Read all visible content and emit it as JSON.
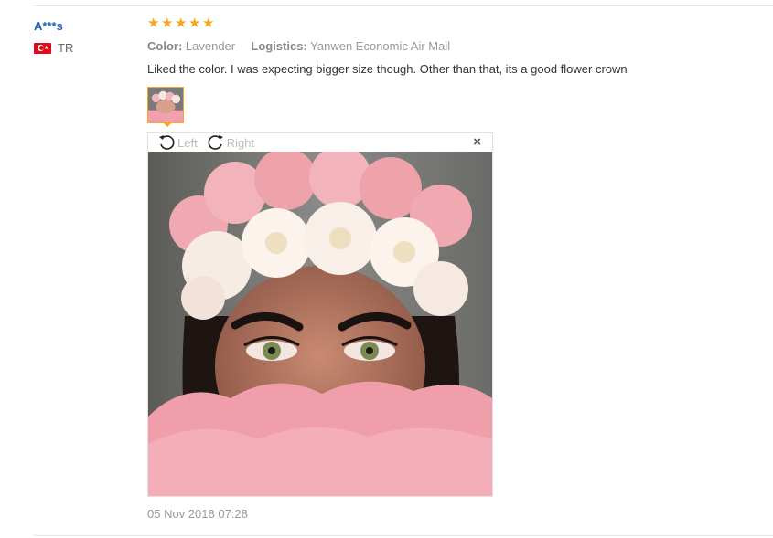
{
  "review": {
    "username": "A***s",
    "country_code": "TR",
    "rating": 5,
    "stars": [
      "★",
      "★",
      "★",
      "★",
      "★"
    ],
    "color_label": "Color:",
    "color_value": "Lavender",
    "logistics_label": "Logistics:",
    "logistics_value": "Yanwen Economic Air Mail",
    "text": "Liked the color. I was expecting bigger size though. Other than that, its a good flower crown",
    "date": "05 Nov 2018 07:28"
  },
  "viewer": {
    "rotate_left_label": "Left",
    "rotate_right_label": "Right",
    "close_glyph": "×"
  },
  "colors": {
    "star": "#f6a623",
    "username": "#1d62b3",
    "thumb_border": "#f5a623"
  },
  "icons": {
    "flag": "turkey-flag-icon",
    "rotate_left": "rotate-left-icon",
    "rotate_right": "rotate-right-icon",
    "close": "close-icon"
  }
}
